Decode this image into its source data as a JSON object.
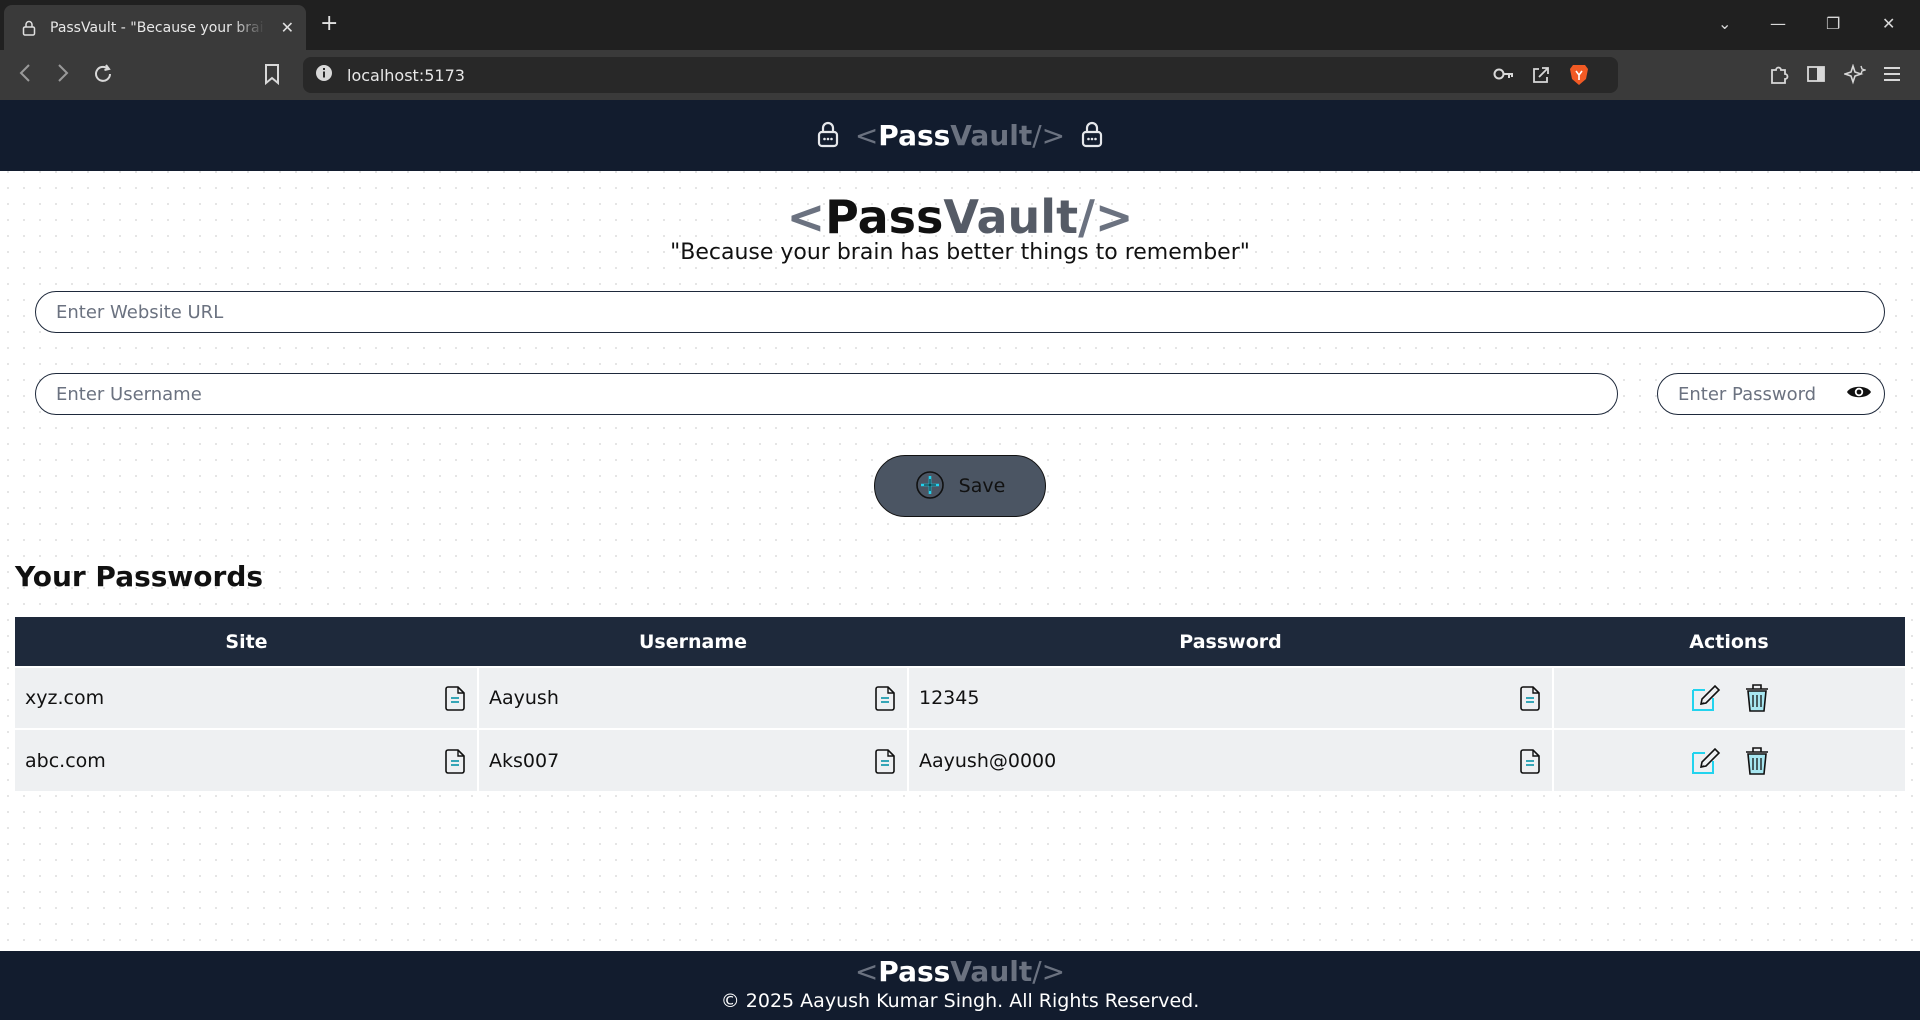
{
  "browser": {
    "tab_title": "PassVault - \"Because your brain has better things to remember\"",
    "tab_close": "✕",
    "new_tab": "+",
    "url": "localhost:5173",
    "win_min": "—",
    "win_max": "❐",
    "win_close": "✕",
    "tab_menu": "⌄"
  },
  "brand": {
    "open": "<",
    "pass": "Pass",
    "vault": "Vault",
    "close": "/>"
  },
  "hero": {
    "tagline": "\"Because your brain has better things to remember\""
  },
  "form": {
    "url_placeholder": "Enter Website URL",
    "username_placeholder": "Enter Username",
    "password_placeholder": "Enter Password",
    "save_label": "Save"
  },
  "passwords": {
    "title": "Your Passwords",
    "columns": [
      "Site",
      "Username",
      "Password",
      "Actions"
    ],
    "rows": [
      {
        "site": "xyz.com",
        "username": "Aayush",
        "password": "12345"
      },
      {
        "site": "abc.com",
        "username": "Aks007",
        "password": "Aayush@0000"
      }
    ]
  },
  "footer": {
    "copyright": "© 2025 Aayush Kumar Singh. All Rights Reserved."
  },
  "colors": {
    "nav_bg": "#121c2e",
    "table_header": "#1e293b",
    "save_button": "#4b5563",
    "accent_cyan": "#22d3ee"
  },
  "icons": [
    "lock-icon",
    "eye-icon",
    "plus-circle-icon",
    "copy-icon",
    "edit-icon",
    "trash-icon"
  ]
}
